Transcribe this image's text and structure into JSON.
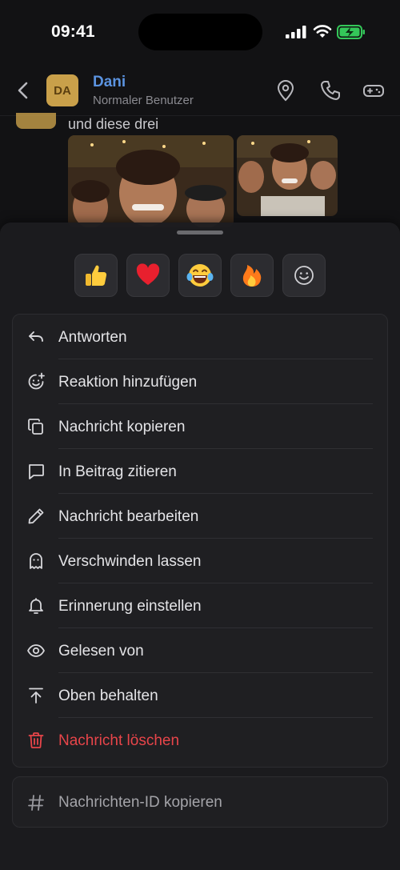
{
  "status": {
    "time": "09:41"
  },
  "header": {
    "avatar_initials": "DA",
    "name": "Dani",
    "role": "Normaler Benutzer"
  },
  "chat": {
    "message_text": "und diese drei"
  },
  "reactions": [
    {
      "emoji": "👍",
      "name": "thumbs-up"
    },
    {
      "emoji": "❤️",
      "name": "heart"
    },
    {
      "emoji": "😂",
      "name": "laughing"
    },
    {
      "emoji": "🔥",
      "name": "fire"
    },
    {
      "emoji": "☺",
      "name": "add-emoji"
    }
  ],
  "menu": {
    "items": [
      {
        "label": "Antworten",
        "icon": "reply-icon"
      },
      {
        "label": "Reaktion hinzufügen",
        "icon": "add-reaction-icon"
      },
      {
        "label": "Nachricht kopieren",
        "icon": "copy-icon"
      },
      {
        "label": "In Beitrag zitieren",
        "icon": "quote-icon"
      },
      {
        "label": "Nachricht bearbeiten",
        "icon": "pencil-icon"
      },
      {
        "label": "Verschwinden lassen",
        "icon": "ghost-icon"
      },
      {
        "label": "Erinnerung einstellen",
        "icon": "bell-icon"
      },
      {
        "label": "Gelesen von",
        "icon": "eye-icon"
      },
      {
        "label": "Oben behalten",
        "icon": "pin-top-icon"
      },
      {
        "label": "Nachricht löschen",
        "icon": "trash-icon"
      }
    ],
    "danger_color": "#e8454a"
  },
  "menu2": {
    "label": "Nachrichten-ID kopieren",
    "icon": "hash-icon"
  },
  "colors": {
    "accent": "#5b93e0",
    "avatar": "#c9a04a",
    "battery": "#34c759"
  }
}
